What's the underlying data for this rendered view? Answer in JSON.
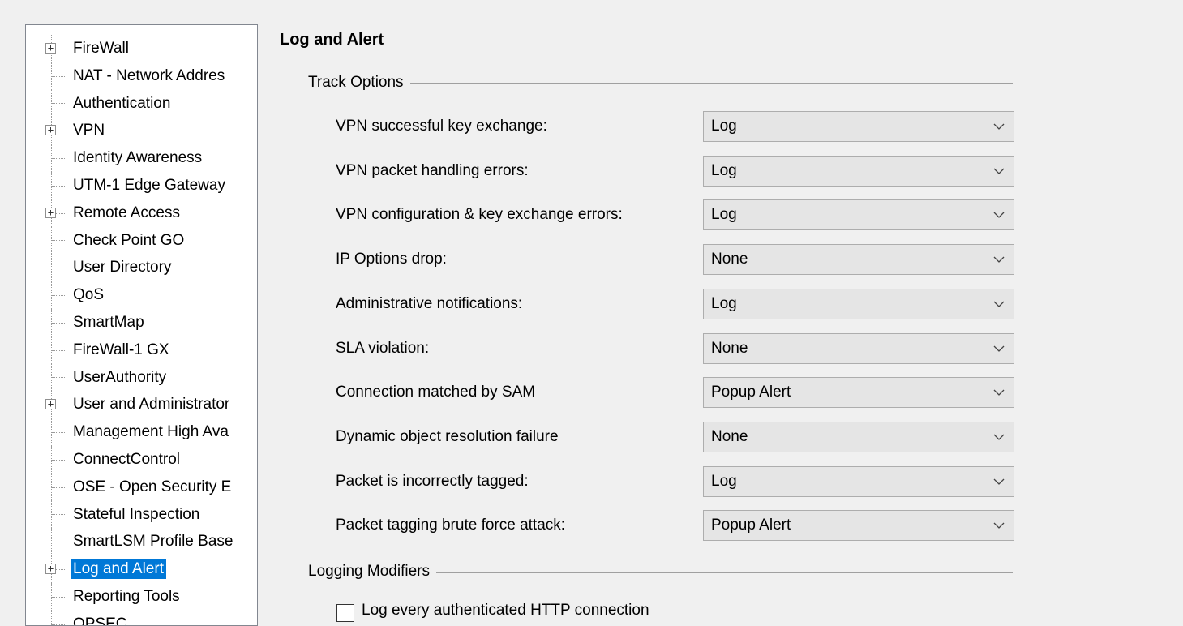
{
  "tree": {
    "items": [
      {
        "label": "FireWall",
        "expandable": true,
        "selected": false
      },
      {
        "label": "NAT - Network Addres",
        "expandable": false,
        "selected": false
      },
      {
        "label": "Authentication",
        "expandable": false,
        "selected": false
      },
      {
        "label": "VPN",
        "expandable": true,
        "selected": false
      },
      {
        "label": "Identity Awareness",
        "expandable": false,
        "selected": false
      },
      {
        "label": "UTM-1 Edge Gateway",
        "expandable": false,
        "selected": false
      },
      {
        "label": "Remote Access",
        "expandable": true,
        "selected": false
      },
      {
        "label": "Check Point GO",
        "expandable": false,
        "selected": false
      },
      {
        "label": "User Directory",
        "expandable": false,
        "selected": false
      },
      {
        "label": "QoS",
        "expandable": false,
        "selected": false
      },
      {
        "label": "SmartMap",
        "expandable": false,
        "selected": false
      },
      {
        "label": "FireWall-1 GX",
        "expandable": false,
        "selected": false
      },
      {
        "label": "UserAuthority",
        "expandable": false,
        "selected": false
      },
      {
        "label": "User and Administrator",
        "expandable": true,
        "selected": false
      },
      {
        "label": "Management High Ava",
        "expandable": false,
        "selected": false
      },
      {
        "label": "ConnectControl",
        "expandable": false,
        "selected": false
      },
      {
        "label": "OSE - Open Security E",
        "expandable": false,
        "selected": false
      },
      {
        "label": "Stateful Inspection",
        "expandable": false,
        "selected": false
      },
      {
        "label": "SmartLSM Profile Base",
        "expandable": false,
        "selected": false
      },
      {
        "label": "Log and Alert",
        "expandable": true,
        "selected": true
      },
      {
        "label": "Reporting Tools",
        "expandable": false,
        "selected": false
      },
      {
        "label": "OPSEC",
        "expandable": false,
        "selected": false
      }
    ],
    "expander_symbol": "+"
  },
  "page": {
    "title": "Log and Alert"
  },
  "track_options": {
    "title": "Track Options",
    "options": [
      {
        "label": "VPN successful key exchange:",
        "value": "Log"
      },
      {
        "label": "VPN packet handling errors:",
        "value": "Log"
      },
      {
        "label": "VPN configuration & key exchange errors:",
        "value": "Log"
      },
      {
        "label": "IP Options drop:",
        "value": "None"
      },
      {
        "label": "Administrative notifications:",
        "value": "Log"
      },
      {
        "label": "SLA violation:",
        "value": "None"
      },
      {
        "label": "Connection matched by SAM",
        "value": "Popup Alert"
      },
      {
        "label": "Dynamic object resolution failure",
        "value": "None"
      },
      {
        "label": "Packet is incorrectly tagged:",
        "value": "Log"
      },
      {
        "label": "Packet tagging brute force attack:",
        "value": "Popup Alert"
      }
    ]
  },
  "logging_modifiers": {
    "title": "Logging Modifiers",
    "checkbox_label": "Log every authenticated HTTP connection",
    "checkbox_checked": false
  },
  "colors": {
    "selection": "#0078d7",
    "combo_background": "#e5e5e5",
    "window_background": "#f0f0f0"
  }
}
